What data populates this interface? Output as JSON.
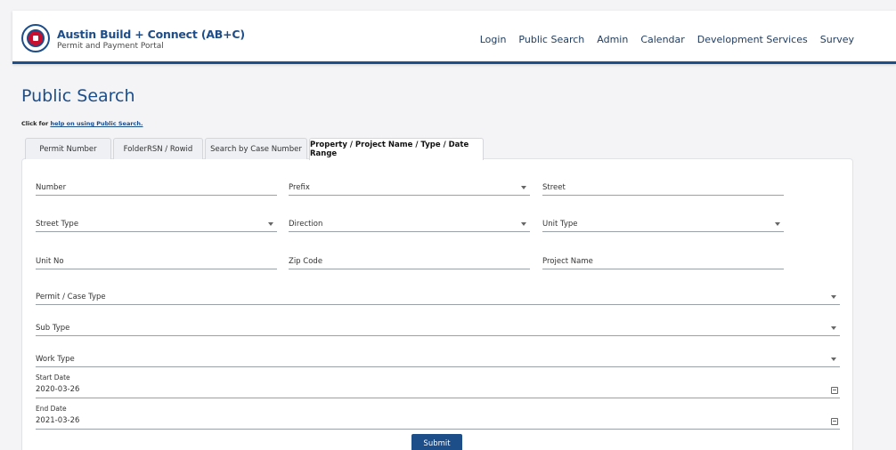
{
  "header": {
    "title": "Austin Build + Connect (AB+C)",
    "subtitle": "Permit and Payment Portal",
    "logo": "city-seal-icon",
    "brand_color": "#1d4e89",
    "nav": [
      "Login",
      "Public Search",
      "Admin",
      "Calendar",
      "Development Services",
      "Survey"
    ]
  },
  "page": {
    "title": "Public Search",
    "help_prefix": "Click for ",
    "help_link": "help on using Public Search."
  },
  "tabs": [
    {
      "label": "Permit Number",
      "active": false
    },
    {
      "label": "FolderRSN / Rowid",
      "active": false
    },
    {
      "label": "Search by Case Number",
      "active": false
    },
    {
      "label": "Property / Project Name / Type / Date Range",
      "active": true
    }
  ],
  "form": {
    "number": "Number",
    "prefix": "Prefix",
    "street": "Street",
    "street_type": "Street Type",
    "direction": "Direction",
    "unit_type": "Unit Type",
    "unit_no": "Unit No",
    "zip_code": "Zip Code",
    "project_name": "Project Name",
    "permit_case_type": "Permit / Case Type",
    "sub_type": "Sub Type",
    "work_type": "Work Type",
    "start_date_label": "Start Date",
    "start_date_value": "2020-03-26",
    "end_date_label": "End Date",
    "end_date_value": "2021-03-26",
    "submit_label": "Submit"
  }
}
